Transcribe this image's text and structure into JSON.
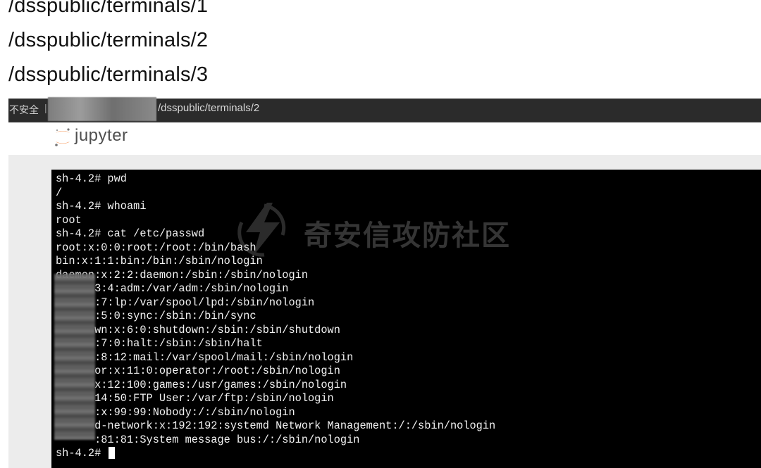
{
  "notes_paths": [
    "/dsspublic/terminals/1",
    "/dsspublic/terminals/2",
    "/dsspublic/terminals/3"
  ],
  "browser": {
    "security_label": "不安全",
    "separator": "|",
    "url_path": "/dsspublic/terminals/2"
  },
  "jupyter": {
    "brand": "jupyter"
  },
  "terminal": {
    "lines": [
      "sh-4.2# pwd",
      "/",
      "sh-4.2# whoami",
      "root",
      "sh-4.2# cat /etc/passwd",
      "root:x:0:0:root:/root:/bin/bash",
      "bin:x:1:1:bin:/bin:/sbin/nologin",
      "daemon:x:2:2:daemon:/sbin:/sbin/nologin",
      "      3:4:adm:/var/adm:/sbin/nologin",
      "      :7:lp:/var/spool/lpd:/sbin/nologin",
      "      :5:0:sync:/sbin:/bin/sync",
      "      wn:x:6:0:shutdown:/sbin:/sbin/shutdown",
      "      :7:0:halt:/sbin:/sbin/halt",
      "      :8:12:mail:/var/spool/mail:/sbin/nologin",
      "      or:x:11:0:operator:/root:/sbin/nologin",
      "      x:12:100:games:/usr/games:/sbin/nologin",
      "      14:50:FTP User:/var/ftp:/sbin/nologin",
      "      :x:99:99:Nobody:/:/sbin/nologin",
      "      d-network:x:192:192:systemd Network Management:/:/sbin/nologin",
      "      :81:81:System message bus:/:/sbin/nologin"
    ],
    "prompt": "sh-4.2# "
  },
  "watermark": {
    "text": "奇安信攻防社区"
  },
  "colors": {
    "terminal_bg": "#000000",
    "terminal_fg": "#f2f2f2",
    "jupyter_orange": "#f37726",
    "browser_bar": "#2b2b2b"
  }
}
